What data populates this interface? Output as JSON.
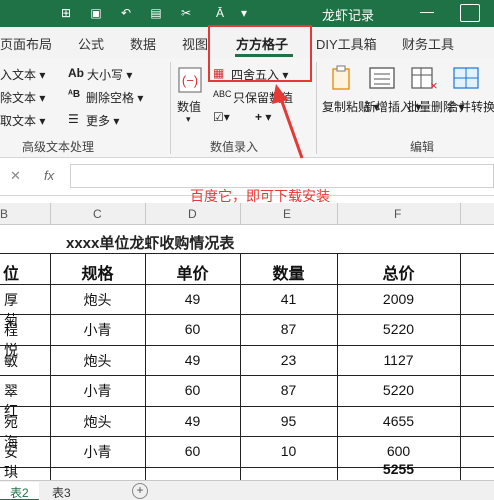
{
  "titlebar": {
    "title": "龙虾记录",
    "minimize": "—"
  },
  "tabs": [
    {
      "label": "页面布局"
    },
    {
      "label": "公式"
    },
    {
      "label": "数据"
    },
    {
      "label": "视图"
    },
    {
      "label": "方方格子"
    },
    {
      "label": "DIY工具箱"
    },
    {
      "label": "财务工具"
    }
  ],
  "ribbon": {
    "text_group": {
      "items": [
        "入文本 ▾",
        "除文本 ▾",
        "取文本 ▾"
      ],
      "size_label": "大小写 ▾",
      "remove_space": "删除空格 ▾",
      "more": "更多 ▾",
      "group_label": "高级文本处理"
    },
    "number_group": {
      "value_label": "数值",
      "round_label": "四舍五入 ▾",
      "keep_label": "只保留数值",
      "group_label": "数值录入"
    },
    "edit_group": {
      "copy_paste": "复制粘贴 ▾",
      "insert": "新增插入 ▾",
      "batch_delete": "批量删除 ▾",
      "merge": "合并转换 ▾",
      "group_label": "编辑"
    }
  },
  "annotation": {
    "text": "百度它，即可下载安装"
  },
  "formula_bar": {
    "cancel": "✕",
    "fx": "fx",
    "value": ""
  },
  "columns": [
    "B",
    "C",
    "D",
    "E",
    "F"
  ],
  "sheet": {
    "title": "xxxx单位龙虾收购情况表",
    "headers": [
      "位",
      "规格",
      "单价",
      "数量",
      "总价"
    ],
    "rows": [
      [
        "厚菊",
        "炮头",
        "49",
        "41",
        "2009"
      ],
      [
        "程悦",
        "小青",
        "60",
        "87",
        "5220"
      ],
      [
        "敏",
        "炮头",
        "49",
        "23",
        "1127"
      ],
      [
        "翠红",
        "小青",
        "60",
        "87",
        "5220"
      ],
      [
        "宛海",
        "炮头",
        "49",
        "95",
        "4655"
      ],
      [
        "安琪",
        "小青",
        "60",
        "10",
        "600"
      ]
    ],
    "total": "5255"
  },
  "sheet_tabs": [
    "表2",
    "表3"
  ],
  "colors": {
    "accent": "#1f7246",
    "annotation": "#e53935"
  }
}
